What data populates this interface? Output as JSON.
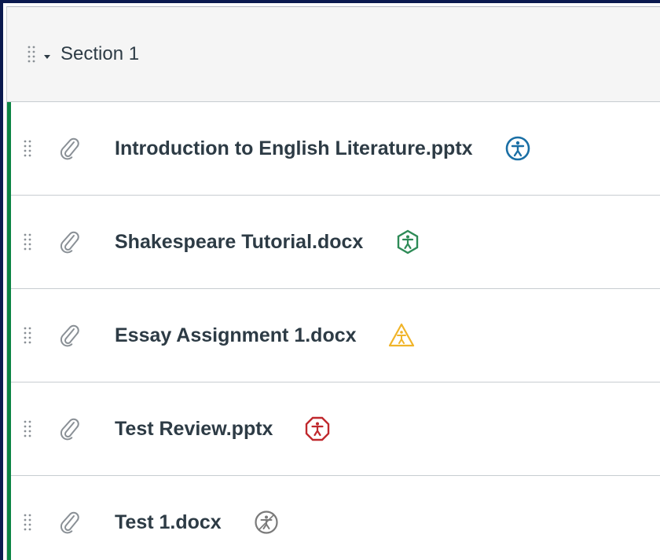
{
  "section": {
    "title": "Section 1"
  },
  "items": [
    {
      "label": "Introduction to English Literature.pptx",
      "accessibility_icon": "accessibility-circle-icon",
      "accessibility_color": "#1a6fa5"
    },
    {
      "label": "Shakespeare Tutorial.docx",
      "accessibility_icon": "accessibility-hexagon-icon",
      "accessibility_color": "#2e8b57"
    },
    {
      "label": "Essay Assignment 1.docx",
      "accessibility_icon": "accessibility-triangle-warning-icon",
      "accessibility_color": "#f0b429"
    },
    {
      "label": "Test Review.pptx",
      "accessibility_icon": "accessibility-octagon-icon",
      "accessibility_color": "#c0282d"
    },
    {
      "label": "Test 1.docx",
      "accessibility_icon": "accessibility-circle-gray-icon",
      "accessibility_color": "#7a7a7a"
    }
  ],
  "colors": {
    "section_border": "#0b8443",
    "frame": "#0b1a4f",
    "text": "#2d3b45"
  }
}
